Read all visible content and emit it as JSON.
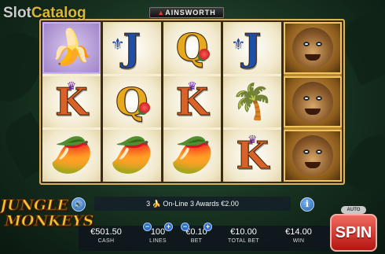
{
  "watermark": {
    "part1": "Slot",
    "part2": "Catalog"
  },
  "provider": {
    "name": "AINSWORTH"
  },
  "game_logo": {
    "line1": "JUNGLE",
    "line2": "MONKEYS"
  },
  "reels": [
    [
      {
        "symbol": "bananas",
        "icon": "🍌",
        "highlight": true
      },
      {
        "symbol": "K",
        "color": "orange",
        "crown": true
      },
      {
        "symbol": "papaya",
        "icon": "🥭"
      }
    ],
    [
      {
        "symbol": "J",
        "color": "blue",
        "fleur": true
      },
      {
        "symbol": "Q",
        "color": "gold",
        "rose": true
      },
      {
        "symbol": "papaya",
        "icon": "🥭"
      }
    ],
    [
      {
        "symbol": "Q",
        "color": "gold",
        "rose": true
      },
      {
        "symbol": "K",
        "color": "orange",
        "crown": true
      },
      {
        "symbol": "papaya",
        "icon": "🥭"
      }
    ],
    [
      {
        "symbol": "J",
        "color": "blue",
        "fleur": true
      },
      {
        "symbol": "palm-tree",
        "icon": "🌴"
      },
      {
        "symbol": "K",
        "color": "orange",
        "crown": true
      }
    ],
    [
      {
        "symbol": "monkey",
        "monkey": true
      },
      {
        "symbol": "monkey",
        "monkey": true
      },
      {
        "symbol": "monkey",
        "monkey": true
      }
    ]
  ],
  "info": {
    "count": "3",
    "text": "On-Line 3 Awards €2.00"
  },
  "stats": {
    "cash": {
      "value": "€501.50",
      "label": "CASH"
    },
    "lines": {
      "value": "100",
      "label": "LINES"
    },
    "bet": {
      "value": "€0.10",
      "label": "BET"
    },
    "total_bet": {
      "value": "€10.00",
      "label": "TOTAL BET"
    },
    "win": {
      "value": "€14.00",
      "label": "WIN"
    }
  },
  "controls": {
    "auto_label": "AUTO",
    "spin_label": "SPIN",
    "plus": "+",
    "minus": "−",
    "sound_icon": "🔊",
    "info_icon": "i"
  },
  "colors": {
    "reel_frame": "#d9b35a",
    "spin_button": "#d8362c",
    "stepper": "#2f6fc4"
  }
}
